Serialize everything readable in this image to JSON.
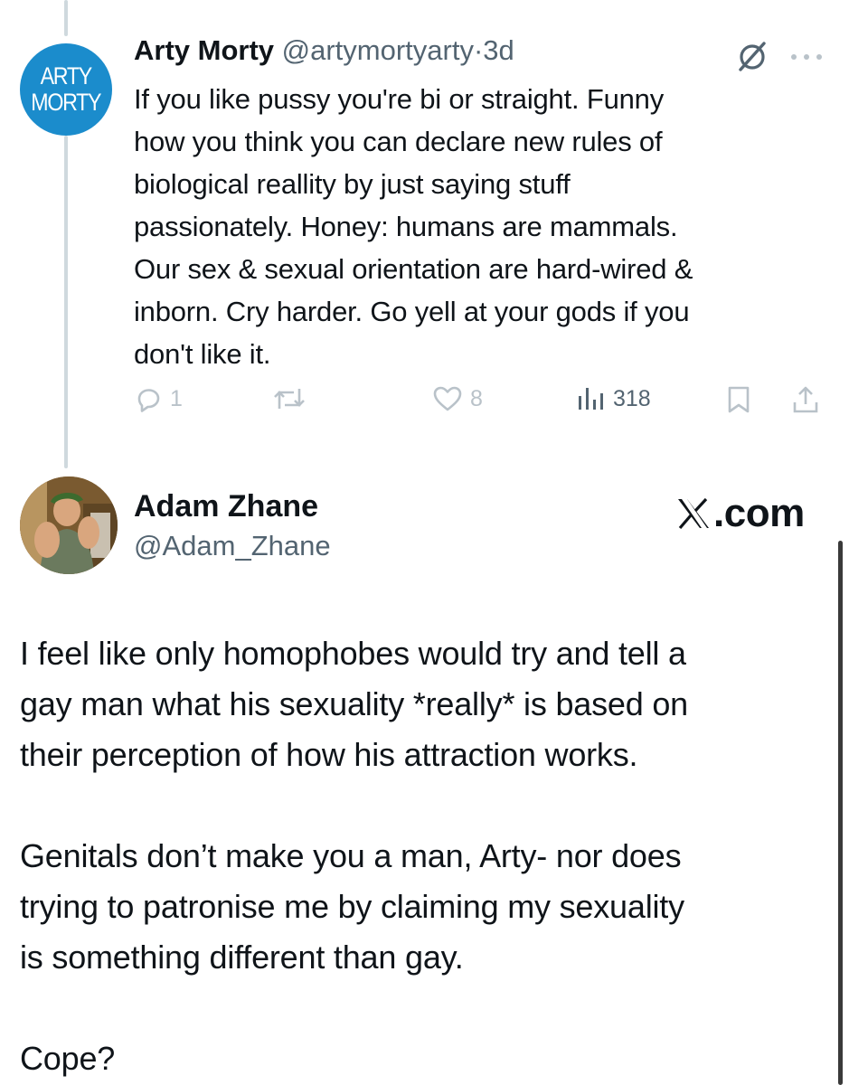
{
  "colors": {
    "text": "#0f1419",
    "muted": "#536471",
    "action_icons": "#b9c2c9",
    "thread_line": "#cfd9de",
    "arty_avatar_bg": "#1b8ccc"
  },
  "parent_tweet": {
    "avatar_text_line1": "ARTY",
    "avatar_text_line2": "MORTY",
    "author_name": "Arty Morty",
    "handle": "@artymortyarty",
    "separator": "·",
    "time": "3d",
    "text": "If you like pussy you're bi or straight. Funny\nhow you think you can declare new rules of\nbiological reallity by just saying stuff\npassionately. Honey: humans are mammals.\nOur sex & sexual orientation are hard-wired &\ninborn. Cry harder. Go yell at your gods if you\ndon't like it.",
    "icons": {
      "grok": "grok-icon",
      "more": "more-icon"
    },
    "actions": {
      "reply_count": "1",
      "repost_count": "",
      "like_count": "8",
      "view_count": "318"
    }
  },
  "reply_tweet": {
    "author_name": "Adam Zhane",
    "handle": "@Adam_Zhane",
    "source_logo": "X",
    "source_logo_text": ".com",
    "text": "I feel like only homophobes would try and tell a\ngay man what his sexuality *really* is based on\ntheir perception of how his attraction works.\n\nGenitals don’t make you a man, Arty- nor does\ntrying to patronise me by claiming my sexuality\nis something different than gay.\n\nCope?"
  }
}
